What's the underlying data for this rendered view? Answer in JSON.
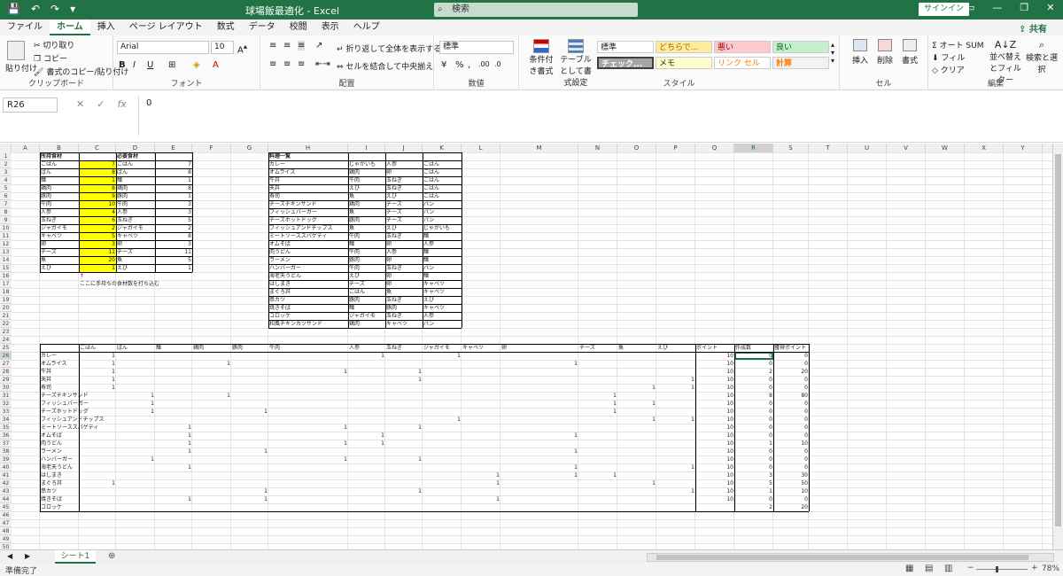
{
  "titlebar": {
    "title": "球場飯最適化  -  Excel",
    "search": "検索",
    "signin": "サインイン",
    "qat": [
      "💾",
      "↶",
      "↷",
      "▾"
    ],
    "win": [
      "▭",
      "—",
      "❐",
      "✕"
    ]
  },
  "tabs": [
    "ファイル",
    "ホーム",
    "挿入",
    "ページ レイアウト",
    "数式",
    "データ",
    "校閲",
    "表示",
    "ヘルプ"
  ],
  "share": "共有",
  "ribbon": {
    "clipboard": {
      "paste": "貼り付け",
      "cut": "切り取り",
      "copy": "コピー",
      "format_painter": "書式のコピー/貼り付け",
      "label": "クリップボード"
    },
    "font": {
      "name": "Arial",
      "size": "10",
      "label": "フォント"
    },
    "align": {
      "wrap": "折り返して全体を表示する",
      "merge": "セルを結合して中央揃え",
      "label": "配置"
    },
    "number": {
      "format": "標準",
      "label": "数値"
    },
    "styles": {
      "conditional": "条件付き書式",
      "table": "テーブルとして書式設定",
      "cells": [
        "標準",
        "どちらで...",
        "悪い",
        "良い",
        "チェック...",
        "メモ",
        "リンク セル",
        "計算"
      ],
      "label": "スタイル"
    },
    "cells_group": {
      "insert": "挿入",
      "delete": "削除",
      "format": "書式",
      "label": "セル"
    },
    "edit": {
      "autosum": "オート SUM",
      "fill": "フィル",
      "clear": "クリア",
      "sort": "並べ替えとフィルター",
      "find": "検索と選択",
      "label": "編集"
    }
  },
  "formulabar": {
    "namebox": "R26",
    "value": "0"
  },
  "columns": [
    "A",
    "B",
    "C",
    "D",
    "E",
    "F",
    "G",
    "H",
    "I",
    "J",
    "K",
    "L",
    "M",
    "N",
    "O",
    "P",
    "Q",
    "R",
    "S",
    "T",
    "U",
    "V",
    "W",
    "X",
    "Y",
    "Z"
  ],
  "top": {
    "h_b": "所持食材",
    "h_d": "必要食材",
    "h_h": "料理一覧",
    "foods": [
      "ごはん",
      "ぱん",
      "麺",
      "鶏肉",
      "豚肉",
      "牛肉",
      "人参",
      "玉ねぎ",
      "ジャガイモ",
      "キャベツ",
      "卵",
      "チーズ",
      "魚",
      "えび"
    ],
    "have": [
      7,
      8,
      1,
      8,
      9,
      10,
      4,
      6,
      2,
      5,
      3,
      11,
      20,
      1
    ],
    "need": [
      7,
      8,
      1,
      8,
      1,
      3,
      3,
      5,
      2,
      8,
      3,
      11,
      5,
      1
    ],
    "arrow": "↑",
    "note": "ここに手持ちの食材数を打ち込む",
    "dishes": [
      [
        "カレー",
        "じゃがいも",
        "人参",
        "ごはん"
      ],
      [
        "オムライス",
        "鶏肉",
        "卵",
        "ごはん"
      ],
      [
        "牛丼",
        "牛肉",
        "玉ねぎ",
        "ごはん"
      ],
      [
        "天丼",
        "えび",
        "玉ねぎ",
        "ごはん"
      ],
      [
        "寿司",
        "魚",
        "えび",
        "ごはん"
      ],
      [
        "チーズチキンサンド",
        "鶏肉",
        "チーズ",
        "パン"
      ],
      [
        "フィッシュバーガー",
        "魚",
        "チーズ",
        "パン"
      ],
      [
        "チーズホットドッグ",
        "豚肉",
        "チーズ",
        "パン"
      ],
      [
        "フィッシュアンドチップス",
        "魚",
        "えび",
        "じゃがいも"
      ],
      [
        "ミートソーススパゲティ",
        "牛肉",
        "玉ねぎ",
        "麺"
      ],
      [
        "オムそば",
        "麺",
        "卵",
        "人参"
      ],
      [
        "肉うどん",
        "牛肉",
        "人参",
        "麺"
      ],
      [
        "ラーメン",
        "豚肉",
        "卵",
        "麺"
      ],
      [
        "ハンバーガー",
        "牛肉",
        "玉ねぎ",
        "パン"
      ],
      [
        "海老天うどん",
        "えび",
        "卵",
        "麺"
      ],
      [
        "はしまき",
        "チーズ",
        "卵",
        "キャベツ"
      ],
      [
        "まぐろ丼",
        "ごはん",
        "魚",
        "キャベツ"
      ],
      [
        "串カツ",
        "豚肉",
        "玉ねぎ",
        "えび"
      ],
      [
        "焼きそば",
        "麺",
        "豚肉",
        "キャベツ"
      ],
      [
        "コロッケ",
        "ジャガイモ",
        "玉ねぎ",
        "人参"
      ],
      [
        "和風チキンカツサンド",
        "鶏肉",
        "キャベツ",
        "パン"
      ]
    ]
  },
  "bottom": {
    "headers": [
      "ごはん",
      "ぱん",
      "麺",
      "鶏肉",
      "豚肉",
      "牛肉",
      "人参",
      "玉ねぎ",
      "ジャガイモ",
      "キャベツ",
      "卵",
      "チーズ",
      "魚",
      "えび",
      "ポイント",
      "作成数",
      "獲得ポイント"
    ],
    "rows": [
      {
        "name": "カレー",
        "c": {
          "0": 1,
          "6": 1,
          "8": 1
        },
        "p": 10,
        "n": 0,
        "g": 0
      },
      {
        "name": "オムライス",
        "c": {
          "0": 1,
          "3": 1,
          "10": 1
        },
        "p": 10,
        "n": 0,
        "g": 0
      },
      {
        "name": "牛丼",
        "c": {
          "0": 1,
          "5": 1,
          "7": 1
        },
        "p": 10,
        "n": 2,
        "g": 20
      },
      {
        "name": "天丼",
        "c": {
          "0": 1,
          "7": 1,
          "13": 1
        },
        "p": 10,
        "n": 0,
        "g": 0
      },
      {
        "name": "寿司",
        "c": {
          "0": 1,
          "12": 1,
          "13": 1
        },
        "p": 10,
        "n": 0,
        "g": 0
      },
      {
        "name": "チーズチキンサンド",
        "c": {
          "1": 1,
          "3": 1,
          "11": 1
        },
        "p": 10,
        "n": 8,
        "g": 80
      },
      {
        "name": "フィッシュバーガー",
        "c": {
          "1": 1,
          "11": 1,
          "12": 1
        },
        "p": 10,
        "n": 0,
        "g": 0
      },
      {
        "name": "チーズホットドッグ",
        "c": {
          "1": 1,
          "4": 1,
          "11": 1
        },
        "p": 10,
        "n": 0,
        "g": 0
      },
      {
        "name": "フィッシュアンドチップス",
        "c": {
          "8": 1,
          "12": 1,
          "13": 1
        },
        "p": 10,
        "n": 0,
        "g": 0
      },
      {
        "name": "ミートソーススパゲティ",
        "c": {
          "2": 1,
          "5": 1,
          "7": 1
        },
        "p": 10,
        "n": 0,
        "g": 0
      },
      {
        "name": "オムそば",
        "c": {
          "2": 1,
          "6": 1,
          "10": 1
        },
        "p": 10,
        "n": 0,
        "g": 0
      },
      {
        "name": "肉うどん",
        "c": {
          "2": 1,
          "5": 1,
          "6": 1
        },
        "p": 10,
        "n": 1,
        "g": 10
      },
      {
        "name": "ラーメン",
        "c": {
          "2": 1,
          "4": 1,
          "10": 1
        },
        "p": 10,
        "n": 0,
        "g": 0
      },
      {
        "name": "ハンバーガー",
        "c": {
          "1": 1,
          "5": 1,
          "7": 1
        },
        "p": 10,
        "n": 0,
        "g": 0
      },
      {
        "name": "海老天うどん",
        "c": {
          "2": 1,
          "10": 1,
          "13": 1
        },
        "p": 10,
        "n": 0,
        "g": 0
      },
      {
        "name": "はしまき",
        "c": {
          "9": 1,
          "10": 1,
          "11": 1
        },
        "p": 10,
        "n": 3,
        "g": 30
      },
      {
        "name": "まぐろ丼",
        "c": {
          "0": 1,
          "9": 1,
          "12": 1
        },
        "p": 10,
        "n": 5,
        "g": 50
      },
      {
        "name": "串カツ",
        "c": {
          "4": 1,
          "7": 1,
          "13": 1
        },
        "p": 10,
        "n": 1,
        "g": 10
      },
      {
        "name": "焼きそば",
        "c": {
          "2": 1,
          "4": 1,
          "9": 1
        },
        "p": 10,
        "n": 0,
        "g": 0
      }
    ],
    "partial": {
      "name": "コロッケ",
      "n": 2,
      "g": 20
    }
  },
  "sheet": {
    "tab": "シート1",
    "add": "⊕",
    "nav": [
      "◀",
      "▶"
    ]
  },
  "status": {
    "left": "準備完了",
    "zoom": "78%",
    "minus": "−",
    "plus": "+"
  }
}
